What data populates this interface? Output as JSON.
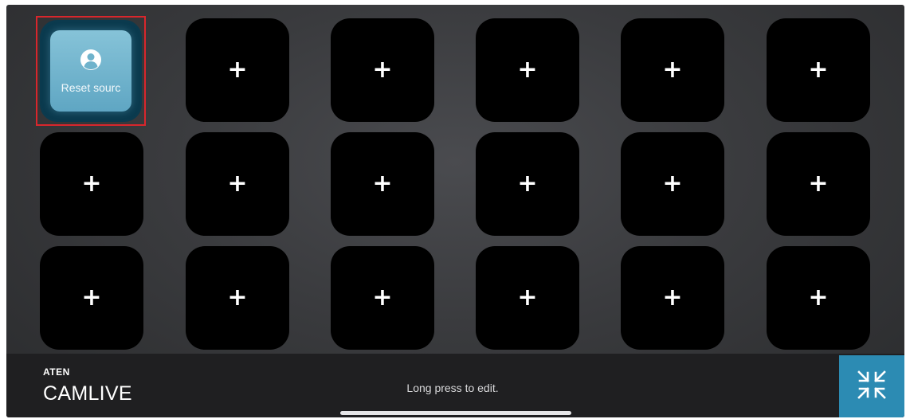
{
  "grid": {
    "active_tile": {
      "label": "Reset sourc",
      "icon": "user-circle-icon"
    },
    "empty_tile_glyph": "+"
  },
  "footer": {
    "brand_company": "ATEN",
    "brand_product": "CAMLIVE",
    "hint": "Long press to edit.",
    "collapse_icon": "collapse-arrows-icon"
  },
  "colors": {
    "highlight_border": "#d9262c",
    "accent": "#2c8bb3",
    "active_tile_face": "#6fb3cc",
    "tile_background": "#000000"
  }
}
